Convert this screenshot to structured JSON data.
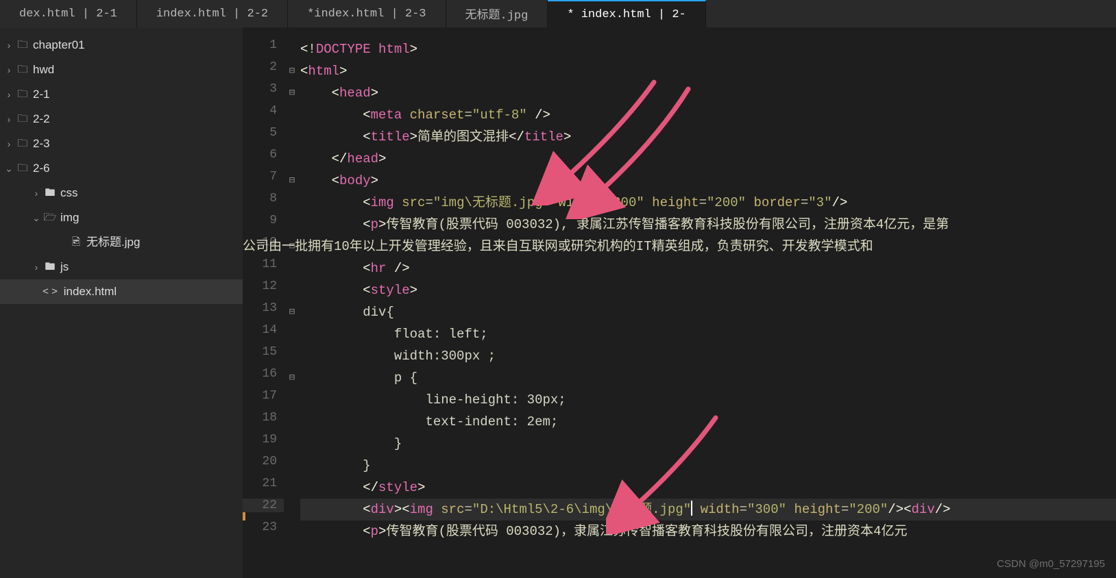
{
  "tabs": [
    {
      "label": "dex.html | 2-1"
    },
    {
      "label": "index.html | 2-2"
    },
    {
      "label": "*index.html | 2-3"
    },
    {
      "label": "无标题.jpg"
    },
    {
      "label": "* index.html | 2-"
    }
  ],
  "active_tab": 4,
  "sidebar": [
    {
      "indent": 0,
      "chevron": "›",
      "icon": "folder",
      "label": "chapter01"
    },
    {
      "indent": 0,
      "chevron": "›",
      "icon": "folder",
      "label": "hwd"
    },
    {
      "indent": 0,
      "chevron": "›",
      "icon": "folder",
      "label": "2-1"
    },
    {
      "indent": 0,
      "chevron": "›",
      "icon": "folder",
      "label": "2-2"
    },
    {
      "indent": 0,
      "chevron": "›",
      "icon": "folder",
      "label": "2-3"
    },
    {
      "indent": 0,
      "chevron": "⌄",
      "icon": "folder",
      "label": "2-6"
    },
    {
      "indent": 1,
      "chevron": "›",
      "icon": "folder-filled",
      "label": "css"
    },
    {
      "indent": 1,
      "chevron": "⌄",
      "icon": "folder-open",
      "label": "img"
    },
    {
      "indent": 2,
      "chevron": "",
      "icon": "image",
      "label": "无标题.jpg"
    },
    {
      "indent": 1,
      "chevron": "›",
      "icon": "folder-filled",
      "label": "js"
    },
    {
      "indent": 1,
      "chevron": "",
      "icon": "code",
      "label": "index.html",
      "selected": true
    }
  ],
  "code": {
    "line1": "<!DOCTYPE html>",
    "title": "简单的图文混排",
    "utf": "utf-8",
    "img1_src": "img\\无标题.jpg",
    "w300": "300",
    "h200": "200",
    "b3": "3",
    "p1": "传智教育(股票代码 003032), 隶属江苏传智播客教育科技股份有限公司，注册资本4亿元，是第",
    "p10": "公司由一批拥有10年以上开发管理经验，且来自互联网或研究机构的IT精英组成，负责研究、开发教学模式和",
    "float": "left",
    "width300": "300px",
    "lh": "30px",
    "ti": "2em",
    "img2_src": "D:\\Html5\\2-6\\img\\无标题.jpg",
    "p22": "传智教育(股票代码 003032)，隶属江苏传智播客教育科技股份有限公司，注册资本4亿元"
  },
  "watermark": "CSDN @m0_57297195"
}
